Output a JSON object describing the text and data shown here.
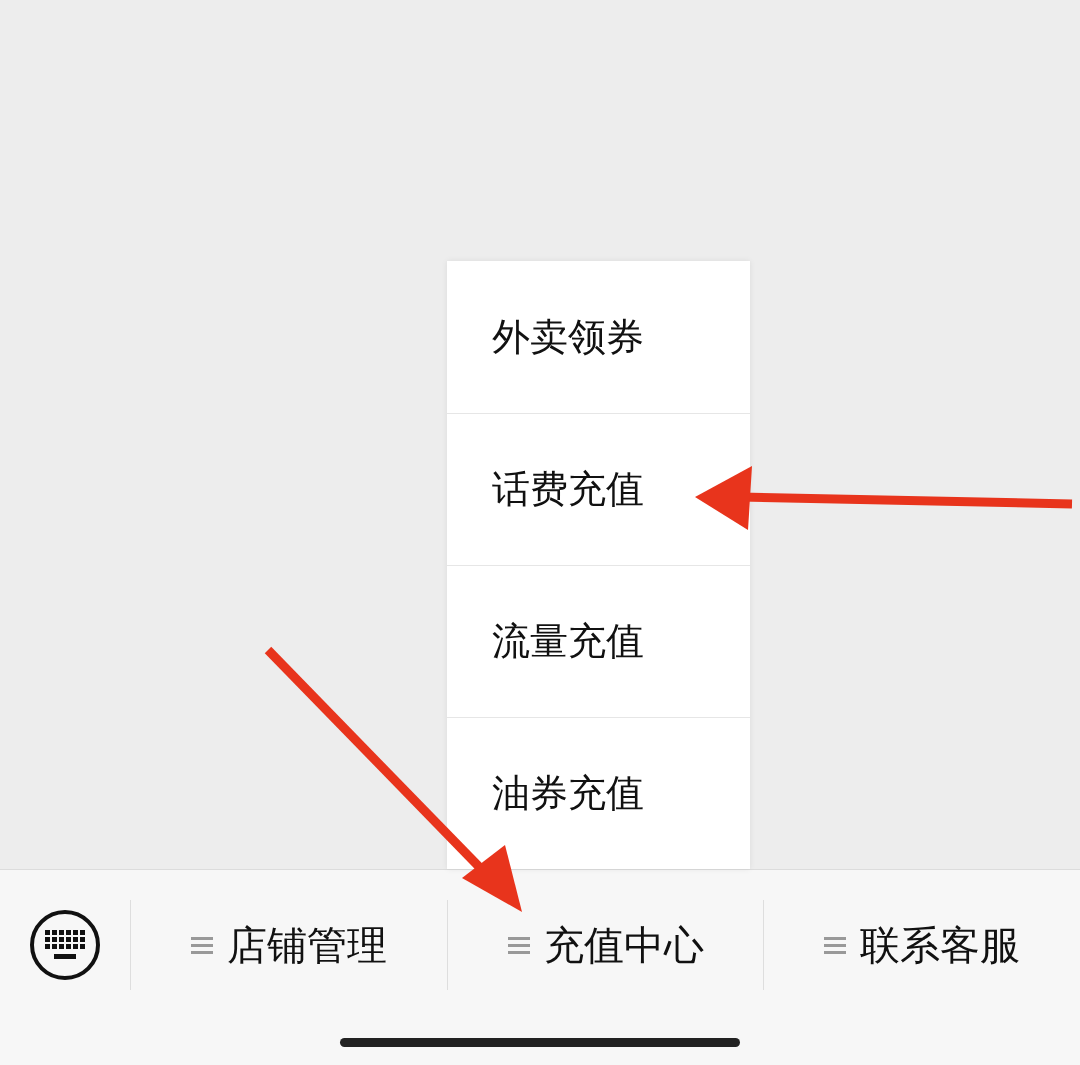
{
  "bottom_menu": {
    "keyboard_button": {
      "kind": "keyboard"
    },
    "items": [
      {
        "label": "店铺管理"
      },
      {
        "label": "充值中心",
        "expanded": true,
        "submenu": [
          {
            "label": "外卖领券"
          },
          {
            "label": "话费充值"
          },
          {
            "label": "流量充值"
          },
          {
            "label": "油券充值"
          }
        ]
      },
      {
        "label": "联系客服"
      }
    ]
  }
}
